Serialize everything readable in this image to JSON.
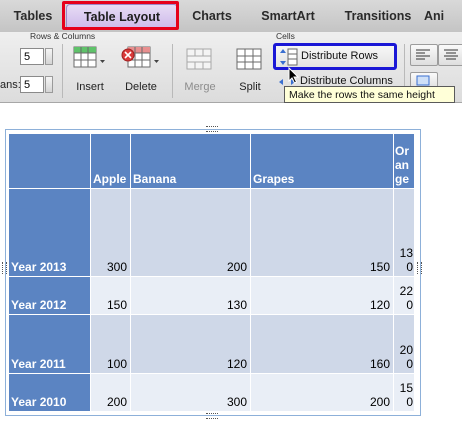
{
  "tabs": [
    {
      "label": "Tables"
    },
    {
      "label": "Table Layout"
    },
    {
      "label": "Charts"
    },
    {
      "label": "SmartArt"
    },
    {
      "label": "Transitions"
    },
    {
      "label": "Ani"
    }
  ],
  "ribbon": {
    "rows_columns_label": "Rows & Columns",
    "cells_label": "Cells",
    "rows_spin_value": "5",
    "columns_spin_value": "5",
    "columns_spin_label": "ans:",
    "insert_label": "Insert",
    "delete_label": "Delete",
    "merge_label": "Merge",
    "split_label": "Split",
    "distribute_rows_label": "Distribute Rows",
    "distribute_columns_label": "Distribute Columns"
  },
  "tooltip": "Make the rows the same height",
  "table": {
    "headers": [
      "",
      "Apple",
      "Banana",
      "Grapes",
      "Or\nan\nge"
    ],
    "rows": [
      {
        "label": "Year 2013",
        "values": [
          "300",
          "200",
          "150",
          "13\n0"
        ]
      },
      {
        "label": "Year 2012",
        "values": [
          "150",
          "130",
          "120",
          "22\n0"
        ]
      },
      {
        "label": "Year 2011",
        "values": [
          "100",
          "120",
          "160",
          "20\n0"
        ]
      },
      {
        "label": "Year 2010",
        "values": [
          "200",
          "300",
          "200",
          "15\n0"
        ]
      }
    ]
  },
  "colors": {
    "header_fill": "#5b84c2",
    "band_dark": "#cfd8e8",
    "band_light": "#e9eef6",
    "highlight_red": "#e6001b",
    "highlight_blue": "#1a17d6"
  }
}
